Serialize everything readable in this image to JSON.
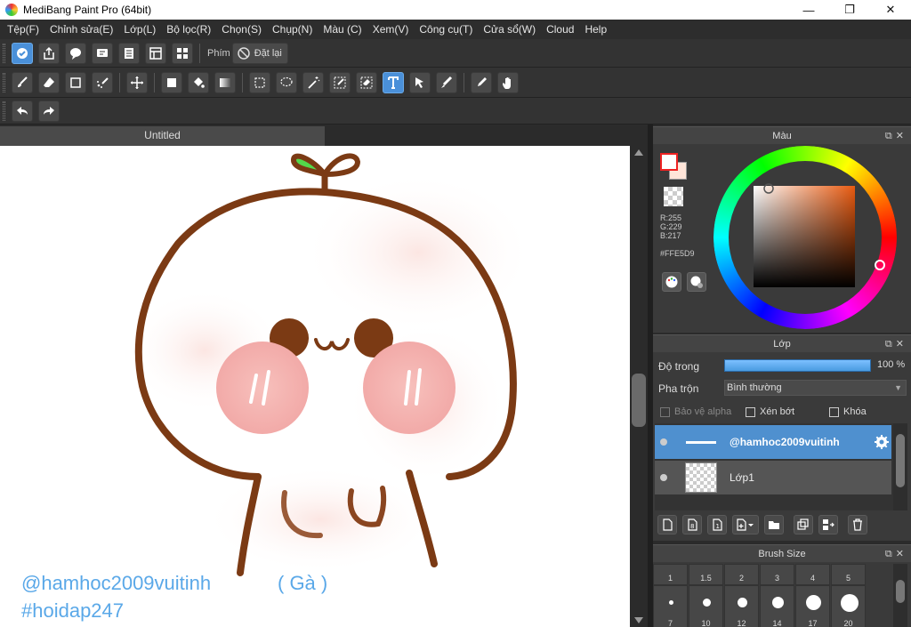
{
  "titlebar": {
    "title": "MediBang Paint Pro (64bit)",
    "minimize": "—",
    "maximize": "❐",
    "close": "✕"
  },
  "menu": [
    "Tệp(F)",
    "Chỉnh sửa(E)",
    "Lớp(L)",
    "Bộ lọc(R)",
    "Chọn(S)",
    "Chụp(N)",
    "Màu (C)",
    "Xem(V)",
    "Công cụ(T)",
    "Cửa sổ(W)",
    "Cloud",
    "Help"
  ],
  "toolbar1": {
    "icons": [
      "cloud-sync-icon",
      "share-icon",
      "comment-icon",
      "message-icon",
      "page-icon",
      "panel-icon",
      "grid-icon"
    ],
    "key_label": "Phím",
    "reset_label": "Đặt lại"
  },
  "toolbar2": {
    "icons": [
      "brush-icon",
      "eraser-icon",
      "rect-icon",
      "dot-brush-icon",
      "move-icon",
      "fill-rect-icon",
      "bucket-icon",
      "gradient-icon",
      "select-rect-icon",
      "lasso-icon",
      "magic-wand-icon",
      "select-pen-icon",
      "select-eraser-icon",
      "text-icon",
      "operation-icon",
      "blur-icon",
      "eyedropper-icon",
      "hand-icon"
    ],
    "active": "text-icon"
  },
  "toolbar3": {
    "icons": [
      "undo-icon",
      "redo-icon"
    ]
  },
  "document": {
    "tab_title": "Untitled"
  },
  "watermark": {
    "line1": "@hamhoc2009vuitinh",
    "line1b": "( Gà )",
    "line2": "#hoidap247"
  },
  "color_panel": {
    "title": "Màu",
    "foreground": "#FFFFFF",
    "background": "#FFE5D9",
    "r": "R:255",
    "g": "G:229",
    "b": "B:217",
    "hex": "#FFE5D9"
  },
  "layer_panel": {
    "title": "Lớp",
    "opacity_label": "Độ trong",
    "opacity_value": "100 %",
    "opacity_fraction": 1.0,
    "blend_label": "Pha trộn",
    "blend_value": "Bình thường",
    "protect_alpha": "Bảo vệ alpha",
    "clipping": "Xén bớt",
    "lock": "Khóa",
    "layers": [
      {
        "name": "@hamhoc2009vuitinh",
        "selected": true
      },
      {
        "name": "Lớp1",
        "selected": false
      }
    ]
  },
  "brush_panel": {
    "title": "Brush Size",
    "sizes": [
      "1",
      "1.5",
      "2",
      "3",
      "4",
      "5",
      "7",
      "10",
      "12",
      "14",
      "17",
      "20"
    ]
  },
  "colors": {
    "accent": "#4A90D9",
    "line_brown": "#7B3A14",
    "blush": "#F4A8A8",
    "leaf": "#4CD137"
  }
}
